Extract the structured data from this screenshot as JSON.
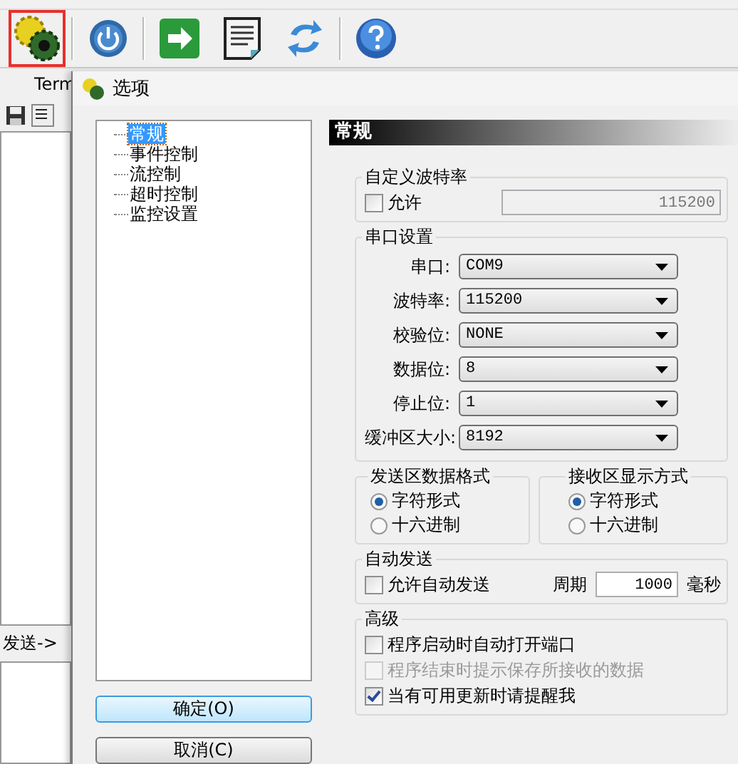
{
  "toolbar": {
    "buttons": [
      {
        "selected": true
      },
      {
        "selected": false
      },
      {
        "selected": false
      },
      {
        "selected": false
      },
      {
        "selected": false
      },
      {
        "selected": false
      }
    ]
  },
  "app": {
    "tab": "Term",
    "send_label": "发送->"
  },
  "dialog": {
    "title": "选项",
    "tree": [
      {
        "label": "常规",
        "selected": true
      },
      {
        "label": "事件控制",
        "selected": false
      },
      {
        "label": "流控制",
        "selected": false
      },
      {
        "label": "超时控制",
        "selected": false
      },
      {
        "label": "监控设置",
        "selected": false
      }
    ],
    "buttons": [
      {
        "label": "确定(O)",
        "default": true
      },
      {
        "label": "取消(C)",
        "default": false
      }
    ],
    "panel_title": "常规",
    "custom_baud": {
      "title": "自定义波特率",
      "checkbox": {
        "label": "允许",
        "checked": false
      },
      "value": "115200",
      "disabled": true
    },
    "serial": {
      "title": "串口设置",
      "rows": [
        {
          "label": "串口:",
          "value": "COM9"
        },
        {
          "label": "波特率:",
          "value": "115200"
        },
        {
          "label": "校验位:",
          "value": "NONE"
        },
        {
          "label": "数据位:",
          "value": "8"
        },
        {
          "label": "停止位:",
          "value": "1"
        },
        {
          "label": "缓冲区大小:",
          "value": "8192"
        }
      ]
    },
    "send_format": {
      "title": "发送区数据格式",
      "options": [
        {
          "label": "字符形式",
          "selected": true
        },
        {
          "label": "十六进制",
          "selected": false
        }
      ]
    },
    "receive_format": {
      "title": "接收区显示方式",
      "options": [
        {
          "label": "字符形式",
          "selected": true
        },
        {
          "label": "十六进制",
          "selected": false
        }
      ]
    },
    "auto_send": {
      "title": "自动发送",
      "checkbox": {
        "label": "允许自动发送",
        "checked": false
      },
      "period_label": "周期",
      "period": "1000",
      "unit": "毫秒"
    },
    "advanced": {
      "title": "高级",
      "options": [
        {
          "label": "程序启动时自动打开端口",
          "checked": false,
          "disabled": false
        },
        {
          "label": "程序结束时提示保存所接收的数据",
          "checked": false,
          "disabled": true
        },
        {
          "label": "当有可用更新时请提醒我",
          "checked": true,
          "disabled": false
        }
      ]
    }
  }
}
